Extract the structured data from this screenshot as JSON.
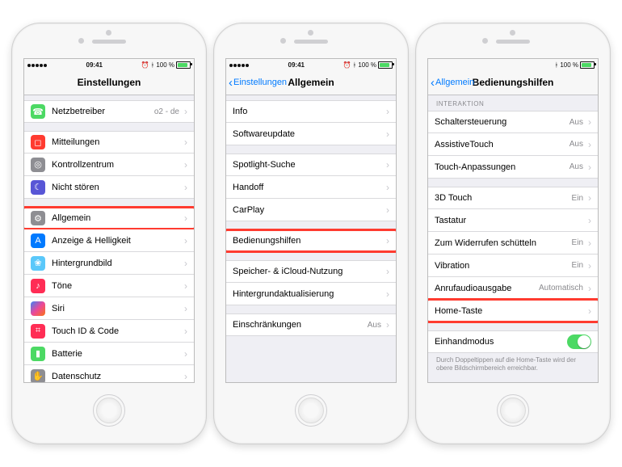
{
  "status": {
    "time": "09:41",
    "battery_pct": "100 %",
    "bt": "✱",
    "alarm": "⏰"
  },
  "phone1": {
    "nav_title": "Einstellungen",
    "groups": [
      {
        "rows": [
          {
            "icon": "ic-phone",
            "glyph": "☎",
            "label": "Netzbetreiber",
            "detail": "o2 - de",
            "name": "row-netzbetreiber"
          }
        ]
      },
      {
        "rows": [
          {
            "icon": "ic-notif",
            "glyph": "◻",
            "label": "Mitteilungen",
            "name": "row-mitteilungen"
          },
          {
            "icon": "ic-ctrl",
            "glyph": "◎",
            "label": "Kontrollzentrum",
            "name": "row-kontrollzentrum"
          },
          {
            "icon": "ic-dnd",
            "glyph": "☾",
            "label": "Nicht stören",
            "name": "row-nicht-stoeren"
          }
        ]
      },
      {
        "rows": [
          {
            "icon": "ic-gen",
            "glyph": "⚙",
            "label": "Allgemein",
            "hl": true,
            "name": "row-allgemein"
          },
          {
            "icon": "ic-disp",
            "glyph": "A",
            "label": "Anzeige & Helligkeit",
            "name": "row-anzeige"
          },
          {
            "icon": "ic-wall",
            "glyph": "❀",
            "label": "Hintergrundbild",
            "name": "row-hintergrund"
          },
          {
            "icon": "ic-sound",
            "glyph": "♪",
            "label": "Töne",
            "name": "row-toene"
          },
          {
            "icon": "ic-siri",
            "glyph": "",
            "label": "Siri",
            "name": "row-siri"
          },
          {
            "icon": "ic-touch",
            "glyph": "⌗",
            "label": "Touch ID & Code",
            "name": "row-touchid"
          },
          {
            "icon": "ic-batt",
            "glyph": "▮",
            "label": "Batterie",
            "name": "row-batterie"
          },
          {
            "icon": "ic-priv",
            "glyph": "✋",
            "label": "Datenschutz",
            "name": "row-datenschutz"
          }
        ]
      }
    ]
  },
  "phone2": {
    "back_label": "Einstellungen",
    "nav_title": "Allgemein",
    "groups": [
      {
        "rows": [
          {
            "label": "Info",
            "name": "row-info"
          },
          {
            "label": "Softwareupdate",
            "name": "row-softwareupdate"
          }
        ]
      },
      {
        "rows": [
          {
            "label": "Spotlight-Suche",
            "name": "row-spotlight"
          },
          {
            "label": "Handoff",
            "name": "row-handoff"
          },
          {
            "label": "CarPlay",
            "name": "row-carplay"
          }
        ]
      },
      {
        "rows": [
          {
            "label": "Bedienungshilfen",
            "hl": true,
            "name": "row-bedienungshilfen"
          }
        ]
      },
      {
        "rows": [
          {
            "label": "Speicher- & iCloud-Nutzung",
            "name": "row-speicher"
          },
          {
            "label": "Hintergrundaktualisierung",
            "name": "row-hintergrundakt"
          }
        ]
      },
      {
        "rows": [
          {
            "label": "Einschränkungen",
            "detail": "Aus",
            "name": "row-einschraenkungen"
          }
        ]
      }
    ]
  },
  "phone3": {
    "back_label": "Allgemein",
    "nav_title": "Bedienungshilfen",
    "section_header": "INTERAKTION",
    "groups": [
      {
        "header": "INTERAKTION",
        "rows": [
          {
            "label": "Schaltersteuerung",
            "detail": "Aus",
            "name": "row-schaltersteuerung"
          },
          {
            "label": "AssistiveTouch",
            "detail": "Aus",
            "name": "row-assistivetouch"
          },
          {
            "label": "Touch-Anpassungen",
            "detail": "Aus",
            "name": "row-touch-anpassungen"
          }
        ]
      },
      {
        "rows": [
          {
            "label": "3D Touch",
            "detail": "Ein",
            "name": "row-3d-touch"
          },
          {
            "label": "Tastatur",
            "name": "row-tastatur"
          },
          {
            "label": "Zum Widerrufen schütteln",
            "detail": "Ein",
            "name": "row-schuetteln"
          },
          {
            "label": "Vibration",
            "detail": "Ein",
            "name": "row-vibration"
          },
          {
            "label": "Anrufaudioausgabe",
            "detail": "Automatisch",
            "name": "row-anrufaudio"
          },
          {
            "label": "Home-Taste",
            "hl": true,
            "name": "row-home-taste"
          }
        ]
      },
      {
        "rows": [
          {
            "label": "Einhandmodus",
            "toggle": true,
            "name": "row-einhandmodus"
          }
        ]
      }
    ],
    "footnote": "Durch Doppeltippen auf die Home-Taste wird der obere Bildschirmbereich erreichbar."
  }
}
